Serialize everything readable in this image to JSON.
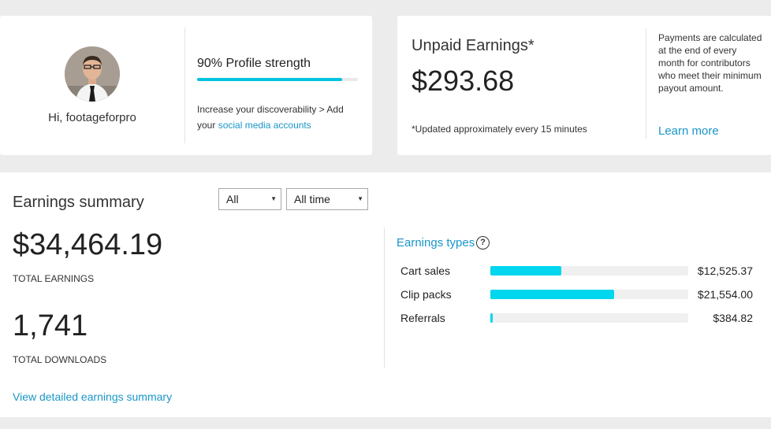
{
  "profile": {
    "greeting": "Hi, footageforpro",
    "strength_title": "90% Profile strength",
    "strength_value": 0.9,
    "tip_text": "Increase your discoverability > Add your ",
    "tip_link": "social media accounts"
  },
  "unpaid": {
    "title": "Unpaid Earnings*",
    "amount": "$293.68",
    "note": "*Updated approximately every 15 minutes",
    "info": "Payments are calculated at the end of every month for contributors who meet their minimum payout amount.",
    "learn_more": "Learn more"
  },
  "summary": {
    "title": "Earnings summary",
    "filter_type": "All",
    "filter_period": "All time",
    "total_earnings": "$34,464.19",
    "total_earnings_label": "TOTAL EARNINGS",
    "total_downloads": "1,741",
    "total_downloads_label": "TOTAL DOWNLOADS",
    "detail_link": "View detailed earnings summary",
    "types_title": "Earnings types",
    "types_help": "?",
    "types": [
      {
        "label": "Cart sales",
        "value": "$12,525.37",
        "fraction": 0.36
      },
      {
        "label": "Clip packs",
        "value": "$21,554.00",
        "fraction": 0.625
      },
      {
        "label": "Referrals",
        "value": "$384.82",
        "fraction": 0.012
      }
    ]
  },
  "colors": {
    "accent": "#00c3e0",
    "link": "#1a96c8",
    "background": "#ececec"
  }
}
